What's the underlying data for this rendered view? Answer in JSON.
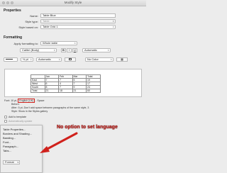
{
  "window": {
    "title": "Modify Style"
  },
  "properties": {
    "heading": "Properties",
    "name_label": "Name:",
    "name_value": "Table Blue",
    "style_type_label": "Style type:",
    "style_type_value": "Table",
    "based_on_label": "Style based on:",
    "based_on_value": "Table Grid 1"
  },
  "formatting": {
    "heading": "Formatting",
    "apply_to_label": "Apply formatting to:",
    "apply_to_value": "Whole table",
    "font_value": "Calibri (Body)",
    "color_value": "Automatic",
    "bold": "B",
    "italic": "I",
    "underline": "U",
    "border_weight": "½ pt",
    "border_color": "Automatic",
    "fill_value": "No Color"
  },
  "preview": {
    "rows": [
      [
        "",
        "Jan",
        "Feb",
        "Mar",
        "Total"
      ],
      [
        "East",
        "7",
        "7",
        "5",
        "19"
      ],
      [
        "West",
        "6",
        "4",
        "7",
        "17"
      ],
      [
        "South",
        "8",
        "7",
        "9",
        "24"
      ],
      [
        "Total",
        "21",
        "18",
        "21",
        "60"
      ]
    ]
  },
  "description": {
    "font_prefix": "Font: 10 pt,",
    "language": "English (UK)",
    "font_suffix": ", Space",
    "line2": "Before:",
    "line3": "After: 5 pt, Don't add space between paragraphs of the same style, 3",
    "line4": "Style: Show in the Styles gallery"
  },
  "options": {
    "add_to_template": "Add to template",
    "automatically_update": "Automatically update"
  },
  "format_button": {
    "label": "Format"
  },
  "format_menu": {
    "items": [
      "Table Properties...",
      "Borders and Shading...",
      "Banding...",
      "Font...",
      "Paragraph...",
      "Tabs..."
    ]
  },
  "annotation": {
    "text": "No option to set language",
    "color": "#d0211c"
  }
}
